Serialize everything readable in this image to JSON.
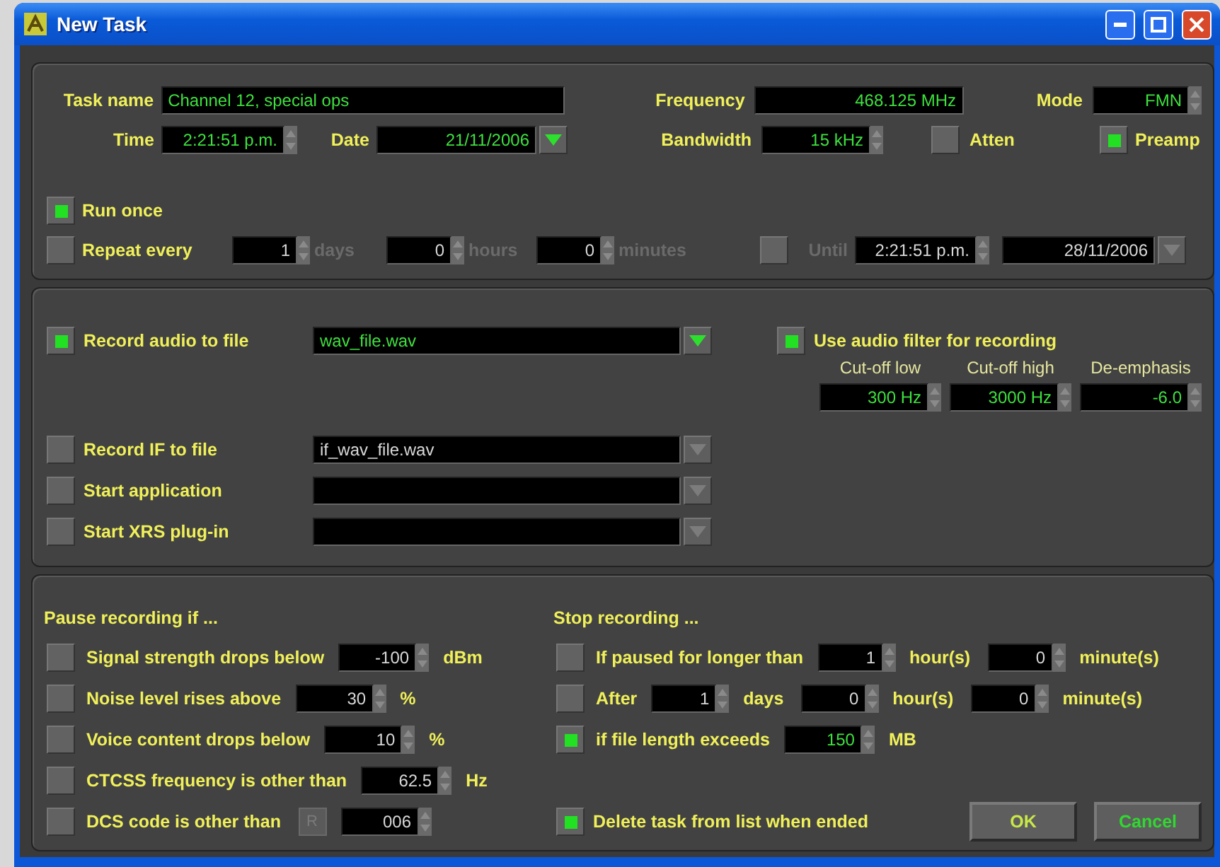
{
  "window": {
    "title": "New Task"
  },
  "task": {
    "name": {
      "label": "Task name",
      "value": "Channel 12, special ops"
    },
    "time": {
      "label": "Time",
      "value": "2:21:51 p.m."
    },
    "date": {
      "label": "Date",
      "value": "21/11/2006"
    },
    "frequency": {
      "label": "Frequency",
      "value": "468.125 MHz"
    },
    "bandwidth": {
      "label": "Bandwidth",
      "value": "15 kHz"
    },
    "mode": {
      "label": "Mode",
      "value": "FMN"
    },
    "atten": {
      "label": "Atten",
      "checked": false
    },
    "preamp": {
      "label": "Preamp",
      "checked": true
    }
  },
  "schedule": {
    "run_once": {
      "label": "Run once",
      "checked": true
    },
    "repeat": {
      "label": "Repeat every",
      "checked": false,
      "disabled": true,
      "intervals": [
        {
          "value": "1",
          "unit": "days"
        },
        {
          "value": "0",
          "unit": "hours"
        },
        {
          "value": "0",
          "unit": "minutes"
        }
      ]
    },
    "until": {
      "label": "Until",
      "checked": false,
      "disabled": true,
      "time": "2:21:51 p.m.",
      "date": "28/11/2006"
    }
  },
  "recording": {
    "audio": {
      "label": "Record audio to file",
      "checked": true,
      "file": "wav_file.wav"
    },
    "filter": {
      "label": "Use audio filter for recording",
      "checked": true,
      "params": [
        {
          "label": "Cut-off low",
          "value": "300 Hz"
        },
        {
          "label": "Cut-off high",
          "value": "3000 Hz"
        },
        {
          "label": "De-emphasis",
          "value": "-6.0"
        }
      ]
    },
    "outputs": [
      {
        "label": "Record IF to file",
        "checked": false,
        "value": "if_wav_file.wav"
      },
      {
        "label": "Start application",
        "checked": false
      },
      {
        "label": "Start XRS plug-in",
        "checked": false
      }
    ]
  },
  "pause": {
    "title": "Pause recording if ...",
    "conditions": [
      {
        "label": "Signal strength drops below",
        "checked": false,
        "fields": [
          {
            "value": "-100",
            "unit": "dBm"
          }
        ]
      },
      {
        "label": "Noise level rises above",
        "checked": false,
        "fields": [
          {
            "value": "30",
            "unit": "%"
          }
        ]
      },
      {
        "label": "Voice content drops below",
        "checked": false,
        "fields": [
          {
            "value": "10",
            "unit": "%"
          }
        ]
      },
      {
        "label": "CTCSS frequency is other than",
        "checked": false,
        "fields": [
          {
            "value": "62.5",
            "unit": "Hz"
          }
        ]
      },
      {
        "label": "DCS code is other than",
        "checked": false,
        "toggle": "R",
        "fields": [
          {
            "value": "006"
          }
        ]
      }
    ]
  },
  "stop": {
    "title": "Stop recording ...",
    "conditions": [
      {
        "label": "If paused for longer than",
        "checked": false,
        "fields": [
          {
            "value": "1",
            "unit": "hour(s)"
          },
          {
            "value": "0",
            "unit": "minute(s)"
          }
        ]
      },
      {
        "label": "After",
        "checked": false,
        "fields": [
          {
            "value": "1",
            "unit": "days"
          },
          {
            "value": "0",
            "unit": "hour(s)"
          },
          {
            "value": "0",
            "unit": "minute(s)"
          }
        ]
      },
      {
        "label": "if file length exceeds",
        "checked": true,
        "fields": [
          {
            "value": "150",
            "unit": "MB"
          }
        ]
      }
    ]
  },
  "delete_task": {
    "label": "Delete task from list when ended",
    "checked": true
  },
  "buttons": [
    {
      "label": "OK",
      "kind": "ok"
    },
    {
      "label": "Cancel",
      "kind": "cancel"
    }
  ]
}
